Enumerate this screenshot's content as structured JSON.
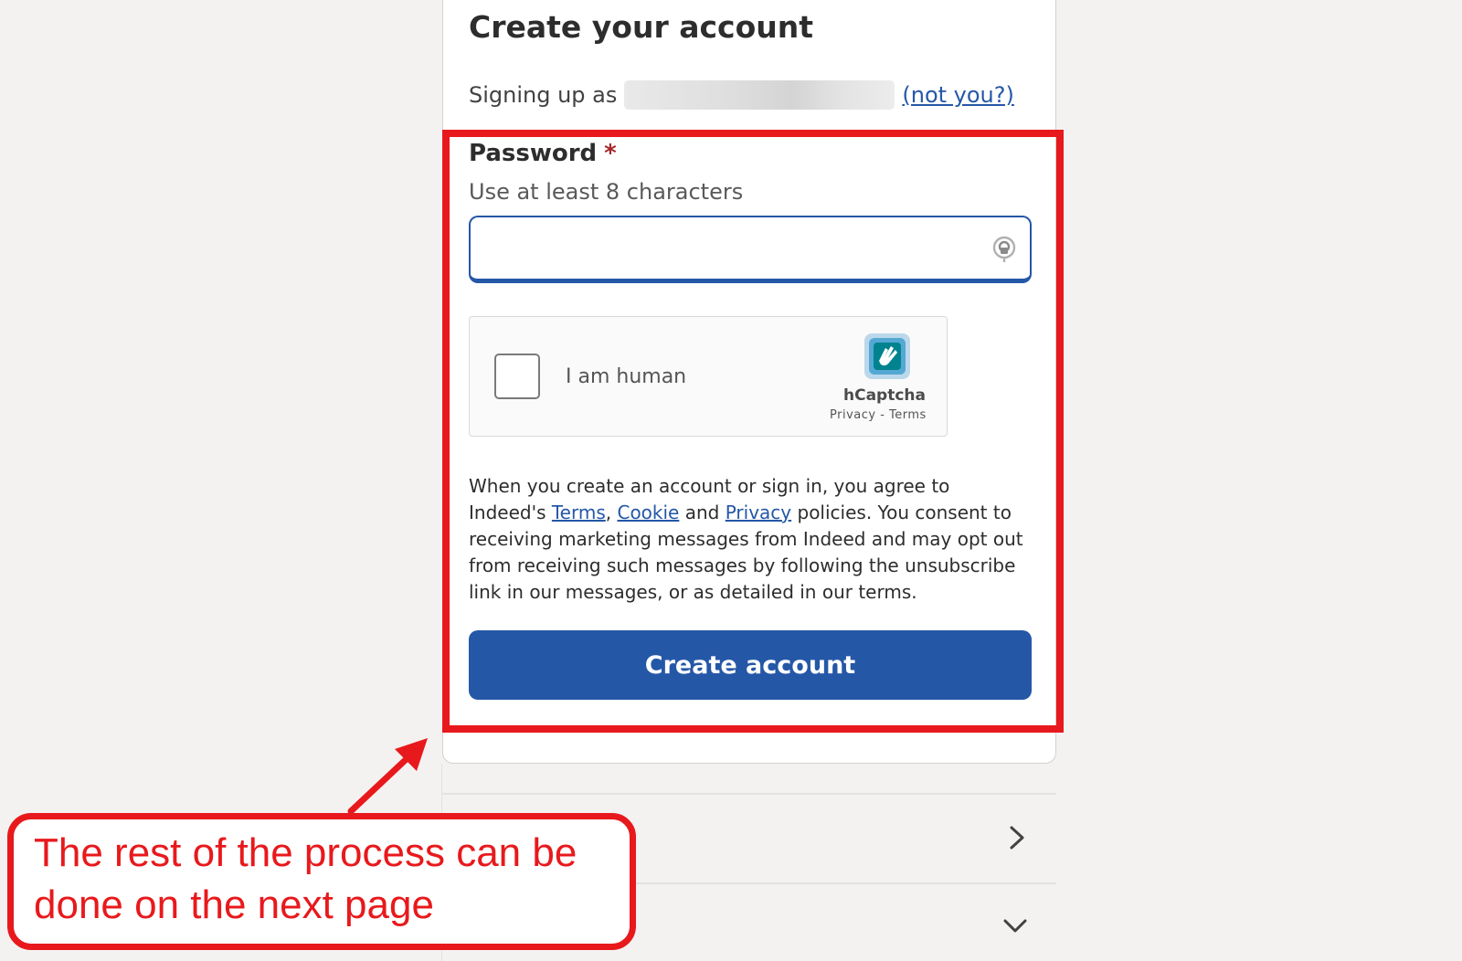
{
  "card": {
    "title": "Create your account",
    "signing_up_prefix": "Signing up as",
    "not_you_link": "(not you?)"
  },
  "password": {
    "label": "Password",
    "required_marker": "*",
    "hint": "Use at least 8 characters",
    "value": "",
    "icon": "password-key-icon"
  },
  "captcha": {
    "label": "I am human",
    "brand": "hCaptcha",
    "privacy_link": "Privacy",
    "separator": " - ",
    "terms_link": "Terms",
    "checked": false
  },
  "legal": {
    "text_1": "When you create an account or sign in, you agree to Indeed's ",
    "terms_link": "Terms",
    "comma": ", ",
    "cookie_link": "Cookie",
    "and": " and ",
    "privacy_link": "Privacy",
    "text_2": " policies. You consent to receiving marketing messages from Indeed and may opt out from receiving such messages by following the unsubscribe link in our messages, or as detailed in our terms."
  },
  "create_button": {
    "label": "Create account"
  },
  "sections": [
    {
      "icon": "chevron-right-icon"
    },
    {
      "icon": "chevron-down-icon"
    }
  ],
  "annotation": {
    "callout_text": "The rest of the process can be done on the next page",
    "color": "#e8191c"
  },
  "colors": {
    "brand_blue": "#2557a7",
    "required_red": "#a9252b",
    "annotation_red": "#e8191c",
    "background": "#f3f2f1"
  }
}
